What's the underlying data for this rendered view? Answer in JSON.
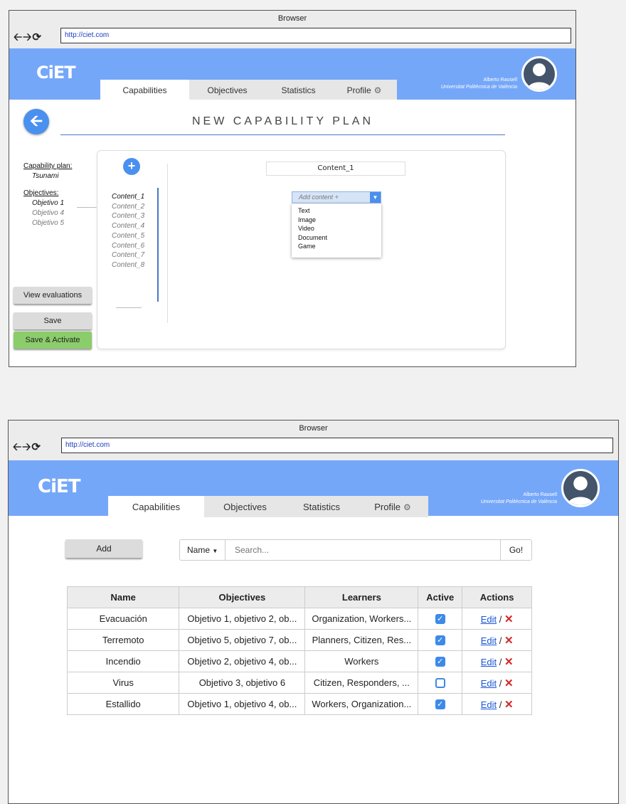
{
  "browser": {
    "title": "Browser",
    "url": "http://ciet.com",
    "nav_icons": [
      "back-arrow-icon",
      "forward-arrow-icon",
      "reload-icon"
    ]
  },
  "app": {
    "logo": "CiET",
    "user_name": "Alberto Rausell",
    "user_org": "Universitat Politècnica de València"
  },
  "tabs": [
    "Capabilities",
    "Objectives",
    "Statistics",
    "Profile"
  ],
  "plan_screen": {
    "title": "NEW CAPABILITY PLAN",
    "plan_label": "Capability plan:",
    "plan_name": "Tsunami",
    "objectives_label": "Objectives:",
    "objectives": [
      "Objetivo 1",
      "Objetivo 4",
      "Objetivo 5"
    ],
    "contents": [
      "Content_1",
      "Content_2",
      "Content_3",
      "Content_4",
      "Content_5",
      "Content_6",
      "Content_7",
      "Content_8"
    ],
    "content_title": "Content_1",
    "add_content_placeholder": "Add content +",
    "add_content_options": [
      "Text",
      "Image",
      "Video",
      "Document",
      "Game"
    ],
    "buttons": {
      "view_evaluations": "View evaluations",
      "save": "Save",
      "save_activate": "Save & Activate"
    }
  },
  "list_screen": {
    "add_button": "Add",
    "filter_field": "Name",
    "search_placeholder": "Search...",
    "go_button": "Go!",
    "columns": [
      "Name",
      "Objectives",
      "Learners",
      "Active",
      "Actions"
    ],
    "rows": [
      {
        "name": "Evacuación",
        "objectives": "Objetivo 1, objetivo 2, ob...",
        "learners": "Organization, Workers...",
        "active": true
      },
      {
        "name": "Terremoto",
        "objectives": "Objetivo 5, objetivo 7, ob...",
        "learners": "Planners, Citizen, Res...",
        "active": true
      },
      {
        "name": "Incendio",
        "objectives": "Objetivo 2, objetivo 4, ob...",
        "learners": "Workers",
        "active": true
      },
      {
        "name": "Virus",
        "objectives": "Objetivo 3, objetivo 6",
        "learners": "Citizen, Responders, ...",
        "active": false
      },
      {
        "name": "Estallido",
        "objectives": "Objetivo 1, objetivo 4, ob...",
        "learners": "Workers, Organization...",
        "active": true
      }
    ],
    "edit_label": "Edit",
    "separator": "/"
  },
  "colors": {
    "banner": "#75a7f9",
    "accent": "#4a90ef",
    "save_activate": "#8ccd6b",
    "delete": "#d62323"
  }
}
